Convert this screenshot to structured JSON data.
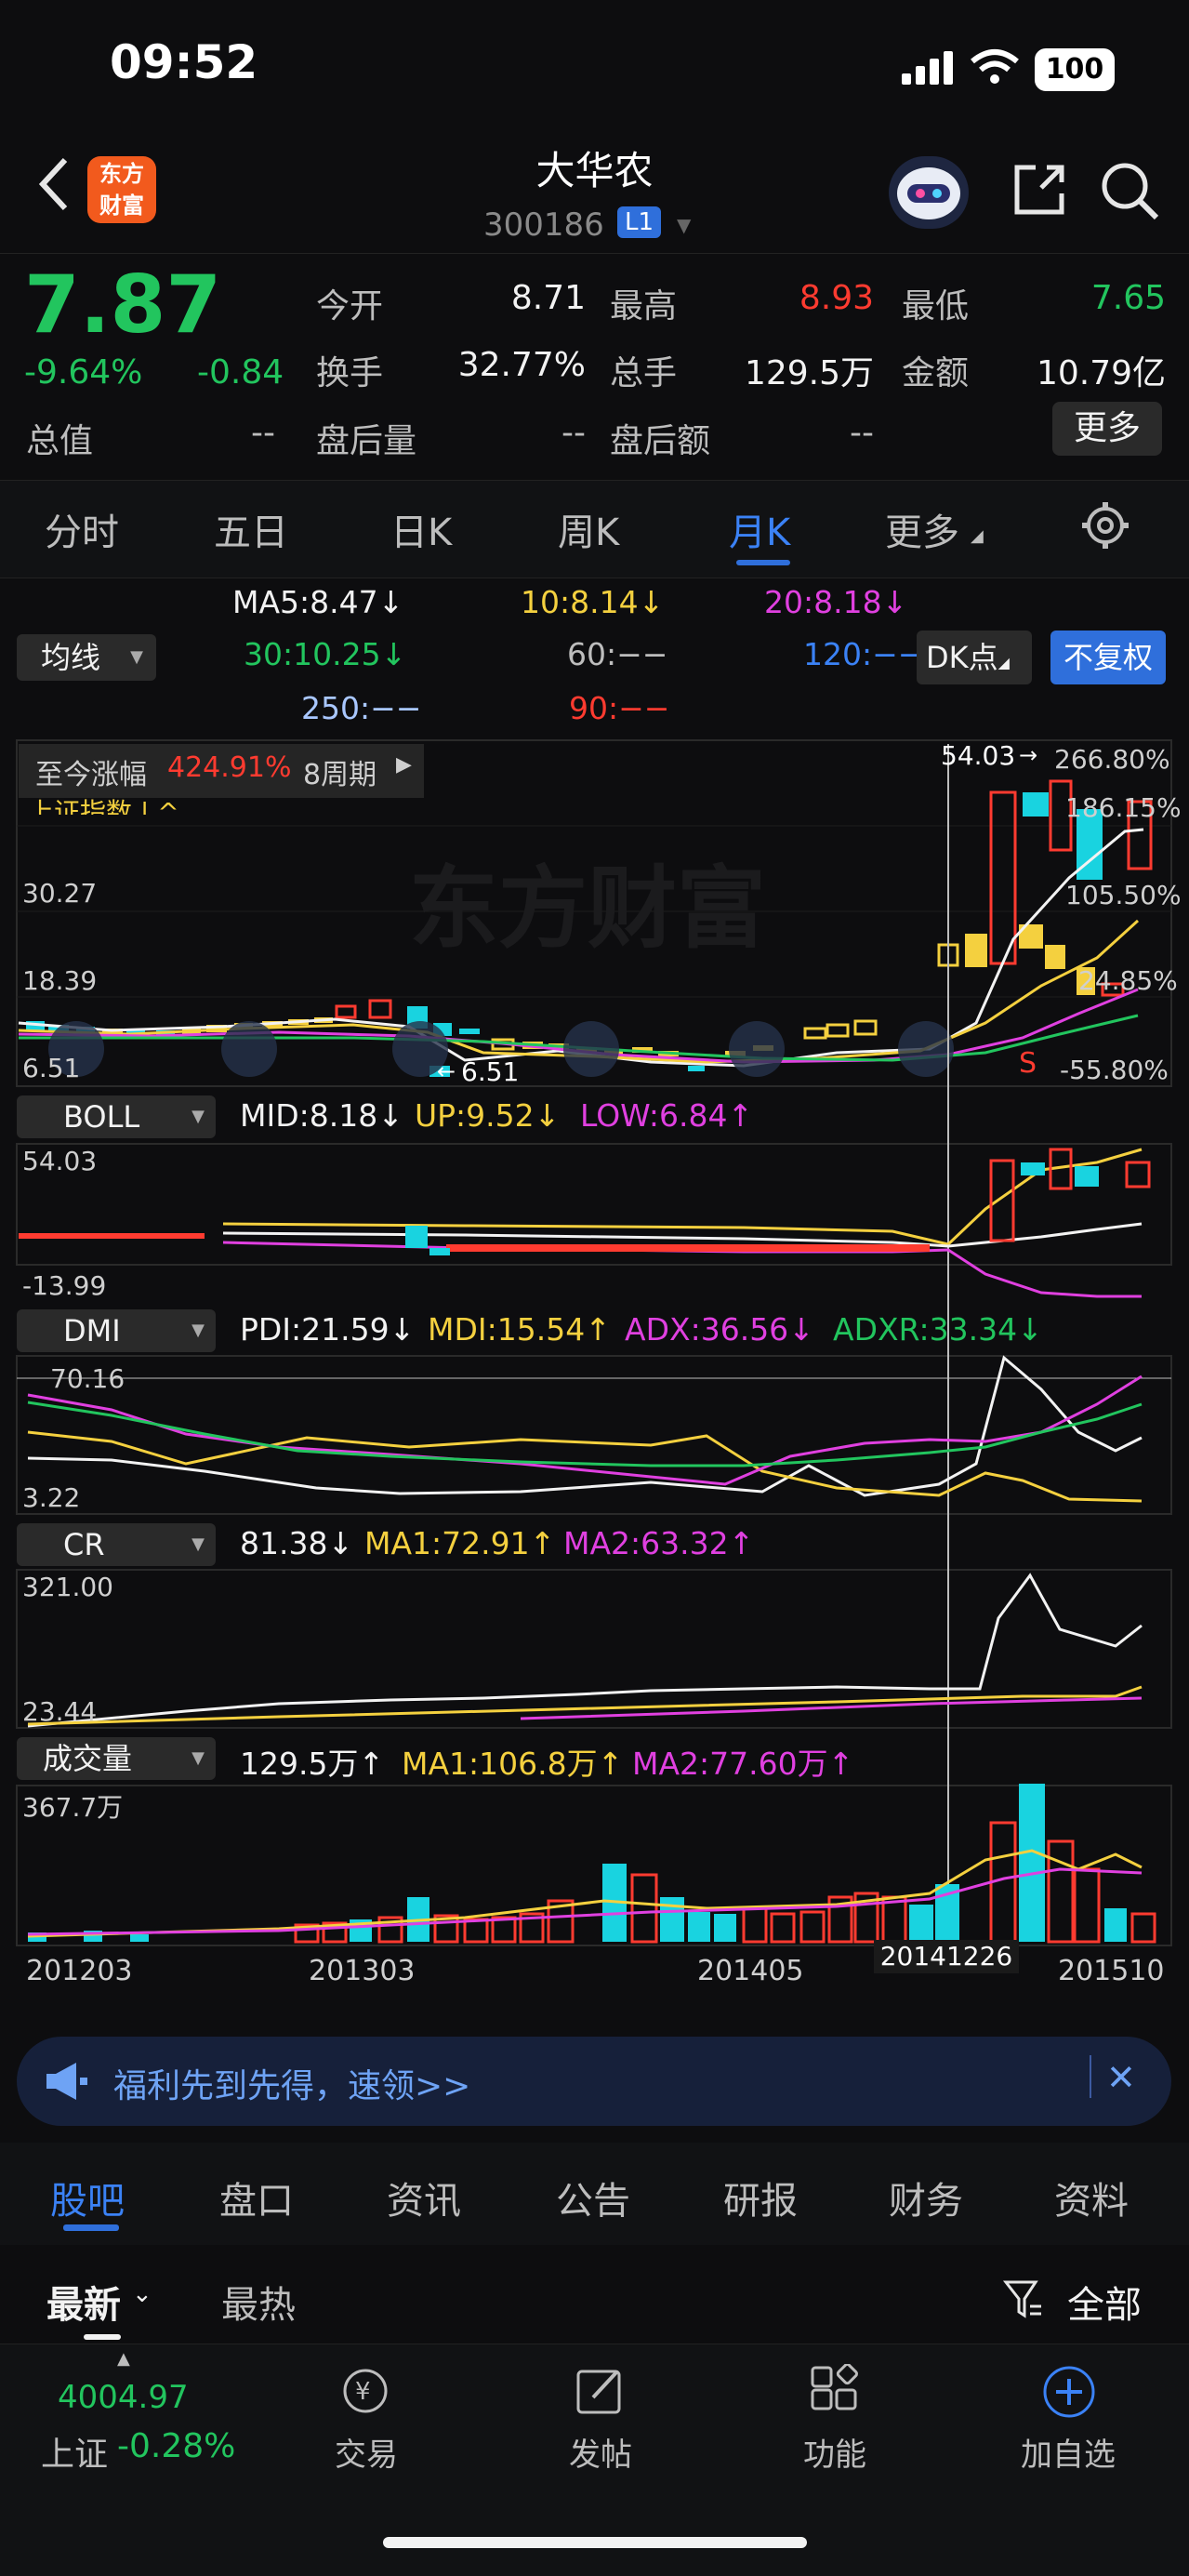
{
  "status_bar": {
    "time": "09:52",
    "battery": "100"
  },
  "header": {
    "logo_text": "东方\n财富",
    "stock_name": "大华农",
    "stock_code": "300186",
    "level_badge": "L1",
    "icons": [
      "back-chevron-icon",
      "robot-avatar-icon",
      "share-icon",
      "search-icon"
    ]
  },
  "quote": {
    "price": "7.87",
    "change_pct": "-9.64%",
    "change": "-0.84",
    "rows": [
      [
        {
          "label": "今开",
          "value": "8.71",
          "color": "#f2f2f2"
        },
        {
          "label": "最高",
          "value": "8.93",
          "color": "#ff3b30"
        },
        {
          "label": "最低",
          "value": "7.65",
          "color": "#22c55e"
        }
      ],
      [
        {
          "label": "换手",
          "value": "32.77%",
          "color": "#f2f2f2"
        },
        {
          "label": "总手",
          "value": "129.5万",
          "color": "#f2f2f2"
        },
        {
          "label": "金额",
          "value": "10.79亿",
          "color": "#f2f2f2"
        }
      ],
      [
        {
          "label": "盘后量",
          "value": "--",
          "color": "#bdbdbd"
        },
        {
          "label": "盘后额",
          "value": "--",
          "color": "#bdbdbd"
        }
      ]
    ],
    "market_cap_label": "总值",
    "market_cap_value": "--",
    "more_label": "更多"
  },
  "period_tabs": [
    "分时",
    "五日",
    "日K",
    "周K",
    "月K",
    "更多"
  ],
  "active_tab": "月K",
  "ma_legend": {
    "selector": "均线",
    "ma5": "MA5:8.47↓",
    "ma10": "10:8.14↓",
    "ma20": "20:8.18↓",
    "ma30": "30:10.25↓",
    "ma60": "60:−−",
    "ma120": "120:−−",
    "ma250": "250:−−",
    "ma90": "90:−−",
    "dk_label": "DK点",
    "fq_label": "不复权"
  },
  "kline_info": {
    "since_label": "至今涨幅",
    "since_value": "424.91%",
    "period_count": "8周期",
    "overlay_label": "上证指数 | ^",
    "y_labels": [
      "30.27",
      "18.39",
      "6.51"
    ],
    "max_label": "54.03",
    "min_label": "6.51",
    "right_pcts": [
      "266.80%",
      "186.15%",
      "105.50%",
      "24.85%",
      "-55.80%"
    ],
    "watermark": "东方财富",
    "signal_s": "S"
  },
  "indicators": {
    "boll": {
      "name": "BOLL",
      "mid": "MID:8.18↓",
      "up": "UP:9.52↓",
      "low": "LOW:6.84↑",
      "ymax": "54.03",
      "ymin": "-13.99"
    },
    "dmi": {
      "name": "DMI",
      "pdi": "PDI:21.59↓",
      "mdi": "MDI:15.54↑",
      "adx": "ADX:36.56↓",
      "adxr": "ADXR:33.34↓",
      "ymax": "70.16",
      "ymin": "3.22"
    },
    "cr": {
      "name": "CR",
      "cr": "81.38↓",
      "ma1": "MA1:72.91↑",
      "ma2": "MA2:63.32↑",
      "ymax": "321.00",
      "ymin": "23.44"
    },
    "vol": {
      "name": "成交量",
      "v": "129.5万↑",
      "ma1": "MA1:106.8万↑",
      "ma2": "MA2:77.60万↑",
      "ymax": "367.7万"
    }
  },
  "x_axis": {
    "labels": [
      "201203",
      "201303",
      "201405",
      "201510"
    ],
    "cursor_label": "20141226"
  },
  "promo": {
    "text": "福利先到先得，速领>>"
  },
  "sub_tabs": [
    "股吧",
    "盘口",
    "资讯",
    "公告",
    "研报",
    "财务",
    "资料"
  ],
  "sort": {
    "latest": "最新",
    "hot": "最热",
    "filter": "全部"
  },
  "toolbar": {
    "index_value": "4004.97",
    "index_name": "上证",
    "index_change": "-0.28%",
    "items": [
      "交易",
      "发帖",
      "功能",
      "加自选"
    ]
  },
  "colors": {
    "up": "#ff3b30",
    "down": "#22c55e",
    "accent": "#2f6fdb",
    "yellow": "#f4d03f",
    "magenta": "#e040e0",
    "cyan": "#19d3e0"
  }
}
